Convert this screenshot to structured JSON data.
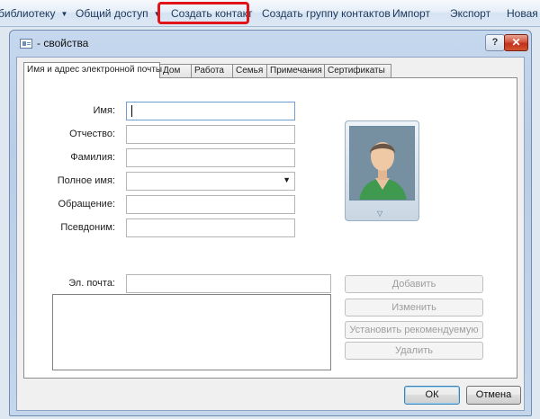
{
  "toolbar": {
    "items": [
      {
        "label": "библиотеку",
        "has_arrow": true
      },
      {
        "label": "Общий доступ",
        "has_arrow": true
      },
      {
        "label": "Создать контакт",
        "has_arrow": false,
        "highlighted": true
      },
      {
        "label": "Создать группу контактов",
        "has_arrow": false
      },
      {
        "label": "Импорт",
        "has_arrow": false
      },
      {
        "label": "Экспорт",
        "has_arrow": false
      },
      {
        "label": "Новая п",
        "has_arrow": false
      }
    ],
    "highlight_color": "#e0151a"
  },
  "window": {
    "title": "- свойства",
    "help_label": "?",
    "close_label": "✕",
    "icon": "contact-card-icon"
  },
  "tabs": [
    {
      "label": "Имя и адрес электронной почты",
      "active": true
    },
    {
      "label": "Дом",
      "active": false
    },
    {
      "label": "Работа",
      "active": false
    },
    {
      "label": "Семья",
      "active": false
    },
    {
      "label": "Примечания",
      "active": false
    },
    {
      "label": "Сертификаты",
      "active": false
    }
  ],
  "form": {
    "first_name": {
      "label": "Имя:",
      "value": ""
    },
    "middle_name": {
      "label": "Отчество:",
      "value": ""
    },
    "last_name": {
      "label": "Фамилия:",
      "value": ""
    },
    "full_name": {
      "label": "Полное имя:",
      "value": ""
    },
    "title": {
      "label": "Обращение:",
      "value": ""
    },
    "nickname": {
      "label": "Псевдоним:",
      "value": ""
    },
    "email": {
      "label": "Эл. почта:",
      "value": ""
    }
  },
  "email_buttons": {
    "add": "Добавить",
    "edit": "Изменить",
    "set_preferred": "Установить рекомендуемую",
    "remove": "Удалить"
  },
  "photo": {
    "icon": "contact-photo-placeholder",
    "dropdown_glyph": "▽"
  },
  "footer": {
    "ok": "ОК",
    "cancel": "Отмена"
  },
  "colors": {
    "accent": "#1e395b",
    "disabled_text": "#9d9d9d"
  }
}
